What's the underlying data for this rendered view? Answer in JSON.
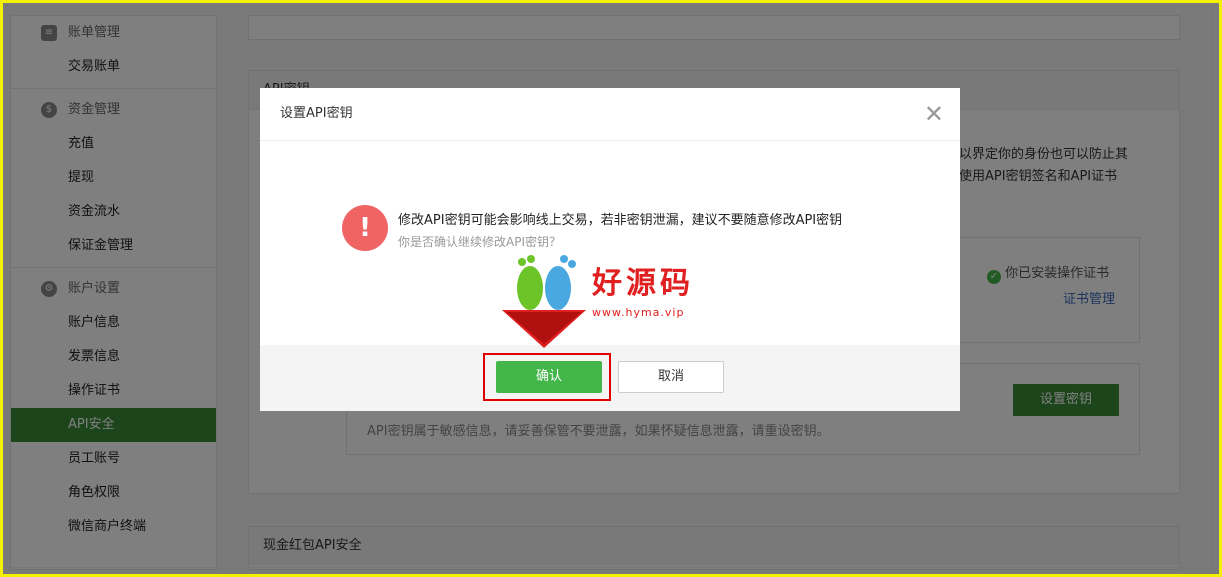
{
  "sidebar": {
    "groups": [
      {
        "icon": "bill-icon",
        "title": "账单管理",
        "items": [
          "交易账单"
        ]
      },
      {
        "icon": "money-bag-icon",
        "title": "资金管理",
        "items": [
          "充值",
          "提现",
          "资金流水",
          "保证金管理"
        ]
      },
      {
        "icon": "settings-gear-icon",
        "title": "账户设置",
        "items": [
          "账户信息",
          "发票信息",
          "操作证书",
          "API安全",
          "员工账号",
          "角色权限",
          "微信商户终端"
        ]
      }
    ],
    "active_item": "API安全"
  },
  "main": {
    "api_section_title": "API密钥",
    "desc_line1": "以界定你的身份也可以防止其",
    "desc_line2": "使用API密钥签名和API证书",
    "cert_installed": "你已安装操作证书",
    "cert_manage_link": "证书管理",
    "set_key_button": "设置密钥",
    "key_note": "API密钥属于敏感信息，请妥善保管不要泄露，如果怀疑信息泄露，请重设密钥。",
    "redpack_section_title": "现金红包API安全"
  },
  "modal": {
    "title": "设置API密钥",
    "close_icon": "close-icon",
    "message": "修改API密钥可能会影响线上交易，若非密钥泄漏，建议不要随意修改API密钥",
    "sub_message": "你是否确认继续修改API密钥？",
    "confirm_label": "确认",
    "cancel_label": "取消"
  },
  "watermark": {
    "title": "好源码",
    "url": "www.hyma.vip"
  },
  "colors": {
    "accent_green": "#44b549",
    "sidebar_active": "#3b8a36",
    "warn_red": "#f06464",
    "highlight_red": "#e00000",
    "frame_yellow": "#f2f200"
  }
}
